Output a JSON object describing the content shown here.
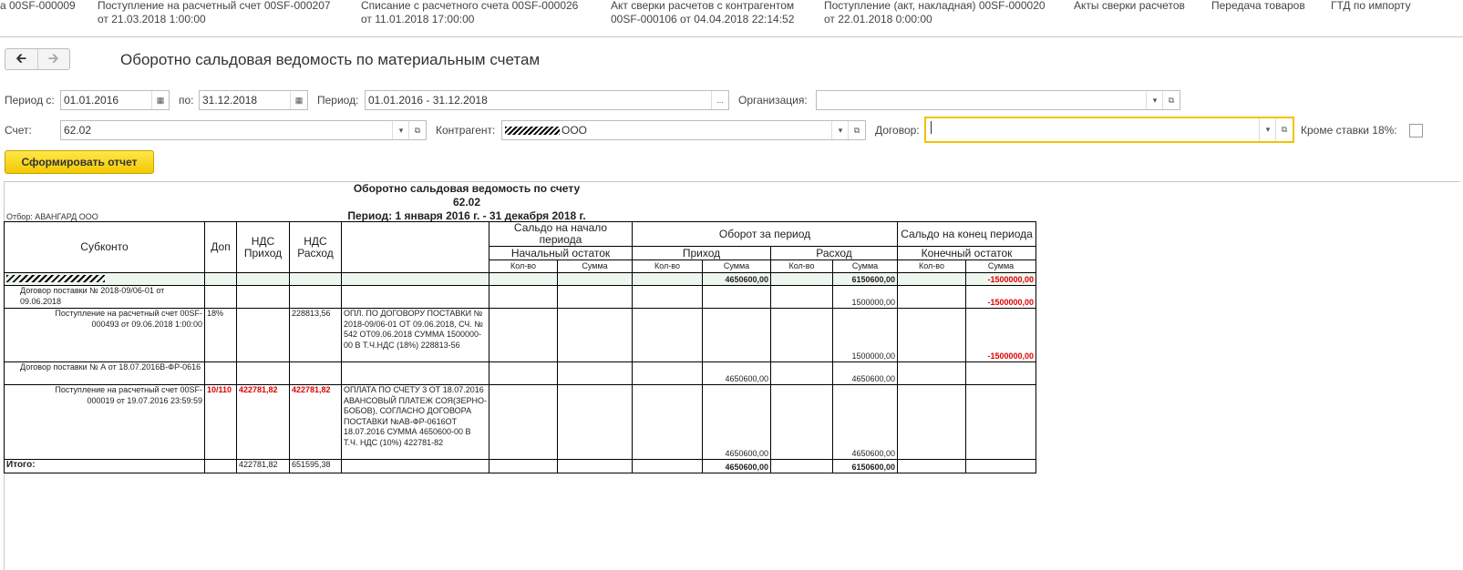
{
  "tabs": [
    {
      "line1": "а 00SF-000009",
      "line2": ""
    },
    {
      "line1": "Поступление на расчетный счет 00SF-000207",
      "line2": "от 21.03.2018 1:00:00"
    },
    {
      "line1": "Списание с расчетного счета 00SF-000026",
      "line2": "от 11.01.2018 17:00:00"
    },
    {
      "line1": "Акт сверки расчетов с контрагентом",
      "line2": "00SF-000106 от 04.04.2018 22:14:52"
    },
    {
      "line1": "Поступление (акт, накладная) 00SF-000020",
      "line2": "от 22.01.2018 0:00:00"
    },
    {
      "line1": "Акты сверки расчетов",
      "line2": ""
    },
    {
      "line1": "Передача товаров",
      "line2": ""
    },
    {
      "line1": "ГТД по импорту",
      "line2": ""
    }
  ],
  "page_title": "Оборотно сальдовая ведомость по материальным счетам",
  "filters": {
    "period_from_label": "Период с:",
    "period_from": "01.01.2016",
    "period_to_label": "по:",
    "period_to": "31.12.2018",
    "period_label": "Период:",
    "period": "01.01.2016 - 31.12.2018",
    "org_label": "Организация:",
    "org": "",
    "account_label": "Счет:",
    "account": "62.02",
    "counterparty_label": "Контрагент:",
    "counterparty": "ООО",
    "contract_label": "Договор:",
    "contract": "",
    "except_rate_label": "Кроме ставки 18%:",
    "except_rate": false
  },
  "generate_button": "Сформировать отчет",
  "report": {
    "title": "Оборотно сальдовая ведомость по счету 62.02",
    "period": "Период: 1 января 2016 г. - 31 декабря 2018 г.",
    "otbor": "Отбор: АВАНГАРД ООО",
    "headers": {
      "subkonto": "Субконто",
      "dop": "Доп",
      "nds_in": "НДС Приход",
      "nds_out": "НДС Расход",
      "saldo_start": "Сальдо на начало периода",
      "oborot": "Оборот за период",
      "saldo_end": "Сальдо на конец периода",
      "start_rest": "Начальный остаток",
      "income": "Приход",
      "expense": "Расход",
      "end_rest": "Конечный остаток",
      "qty": "Кол-во",
      "sum": "Сумма"
    },
    "group_row": {
      "income_sum": "4650600,00",
      "expense_sum": "6150600,00",
      "end_sum": "-1500000,00"
    },
    "contract1": {
      "name": "Договор поставки № 2018-09/06-01 от 09.06.2018",
      "expense_sum": "1500000,00",
      "end_sum": "-1500000,00"
    },
    "doc1": {
      "name": "Поступление на расчетный счет 00SF-000493 от 09.06.2018 1:00:00",
      "dop": "18%",
      "nds_out": "228813,56",
      "comment": "ОПЛ. ПО ДОГОВОРУ ПОСТАВКИ № 2018-09/06-01 ОТ 09.06.2018, СЧ. № 542 ОТ09.06.2018 СУММА 1500000-00 В Т.Ч.НДС (18%) 228813-56",
      "expense_sum": "1500000,00",
      "end_sum": "-1500000,00"
    },
    "contract2": {
      "name": "Договор поставки № А от 18.07.2016В-ФР-0616",
      "income_sum": "4650600,00",
      "expense_sum": "4650600,00"
    },
    "doc2": {
      "name": "Поступление на расчетный счет 00SF-000019 от 19.07.2016 23:59:59",
      "dop": "10/110",
      "nds_in": "422781,82",
      "nds_out": "422781,82",
      "comment": "ОПЛАТА ПО СЧЕТУ 3 ОТ 18.07.2016 АВАНСОВЫЙ ПЛАТЕЖ СОЯ(ЗЕРНО-БОБОВ), СОГЛАСНО ДОГОВОРА ПОСТАВКИ №АВ-ФР-0616ОТ 18.07.2016 СУММА 4650600-00 В Т.Ч. НДС (10%) 422781-82",
      "income_sum": "4650600,00",
      "expense_sum": "4650600,00"
    },
    "total": {
      "label": "Итого:",
      "nds_in": "422781,82",
      "nds_out": "651595,38",
      "income_sum": "4650600,00",
      "expense_sum": "6150600,00"
    }
  }
}
